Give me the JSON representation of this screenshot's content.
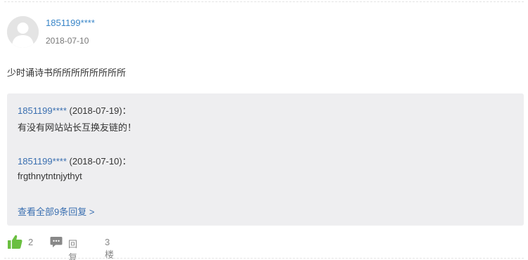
{
  "comment": {
    "username": "1851199****",
    "date": "2018-07-10",
    "text": "少时诵诗书所所所所所所所所"
  },
  "replies": [
    {
      "user": "1851199****",
      "date_text": "(2018-07-19)：",
      "body": "有没有网站站长互换友链的！"
    },
    {
      "user": "1851199****",
      "date_text": "(2018-07-10)：",
      "body": "frgthnytntnjythyt"
    }
  ],
  "view_all_label": "查看全部9条回复 >",
  "actions": {
    "like_count": "2",
    "reply_label": "回复",
    "floor_label": "3楼"
  },
  "colors": {
    "username": "#3a86c8",
    "reply_user": "#3a6fb0",
    "like_icon": "#6abf40",
    "reply_box_bg": "#eeeef0"
  },
  "icons": {
    "avatar": "default-user-avatar",
    "like": "thumbs-up-icon",
    "reply": "comment-bubble-icon"
  }
}
